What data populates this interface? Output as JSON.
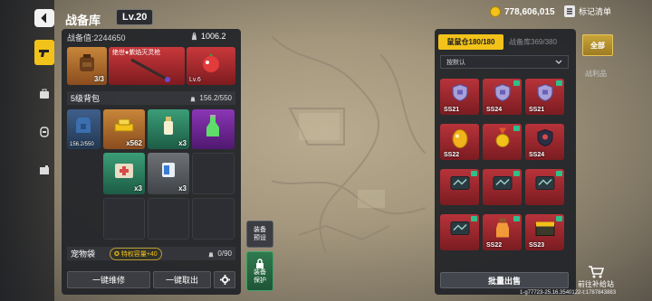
{
  "header": {
    "title": "战备库",
    "level": "Lv.20",
    "coins": "778,606,015",
    "mark_list_label": "标记清单"
  },
  "left_panel": {
    "power_label": "战备值:2244650",
    "weight": "1006.2",
    "top_items": [
      {
        "rarity": "orange",
        "icon": "backpack-icon",
        "count": "3/3"
      },
      {
        "rarity": "red",
        "icon": "flame-staff-icon",
        "label": "绝世●紫焰灭灵枪"
      },
      {
        "rarity": "red",
        "icon": "pet-icon",
        "label": "Lv.6"
      }
    ],
    "backpack": {
      "title": "5级背包",
      "capacity": "156.2/550",
      "items": [
        {
          "rarity": "blue",
          "icon": "armor-vest-icon",
          "label": "156.2/550"
        },
        {
          "rarity": "orange",
          "icon": "gold-bars-icon",
          "count": "x562"
        },
        {
          "rarity": "green",
          "icon": "bottle-icon",
          "count": "x3"
        },
        {
          "rarity": "purple",
          "icon": "potion-icon",
          "count": ""
        },
        {
          "rarity": "green",
          "icon": "medkit-icon",
          "count": "x3"
        },
        {
          "rarity": "grey",
          "icon": "ammo-icon",
          "count": "x3"
        }
      ]
    },
    "pet_bag": {
      "title": "宠物袋",
      "privilege": "特权容量+40",
      "capacity": "0/90"
    },
    "buttons": {
      "repair": "一键维修",
      "take_out": "一键取出"
    },
    "side_buttons": {
      "preset": "装备\n预设",
      "protect": "装备\n保护"
    }
  },
  "right_panel": {
    "tab_active": "鼠鼠仓180/180",
    "tab_inactive": "战备库369/380",
    "sort_label": "按默认",
    "items": [
      {
        "label": "SS21",
        "icon": "shield-badge-icon",
        "dot": false
      },
      {
        "label": "SS24",
        "icon": "shield-badge-icon",
        "dot": true
      },
      {
        "label": "SS21",
        "icon": "shield-badge-icon",
        "dot": true
      },
      {
        "label": "SS22",
        "icon": "egg-icon",
        "dot": false
      },
      {
        "label": "",
        "icon": "medal-icon",
        "dot": true
      },
      {
        "label": "SS24",
        "icon": "dark-shield-icon",
        "dot": false
      },
      {
        "label": "",
        "icon": "card-icon",
        "dot": true
      },
      {
        "label": "",
        "icon": "card-icon",
        "dot": true
      },
      {
        "label": "",
        "icon": "card-icon",
        "dot": true
      },
      {
        "label": "",
        "icon": "card-icon",
        "dot": true
      },
      {
        "label": "SS22",
        "icon": "jar-icon",
        "dot": true
      },
      {
        "label": "SS23",
        "icon": "chest-icon",
        "dot": true
      }
    ],
    "sell_button": "批量出售"
  },
  "far_right": {
    "all_button": "全部",
    "loot_tab": "战利品",
    "supply_label": "前往补给站"
  },
  "version": "1-g77723-25.16.3540122-t:1787843883",
  "colors": {
    "accent": "#f2c21a",
    "rarity_red": "#b8333a",
    "rarity_green": "#3b9d77",
    "rarity_orange": "#c8863a",
    "rarity_purple": "#8b36b5"
  }
}
